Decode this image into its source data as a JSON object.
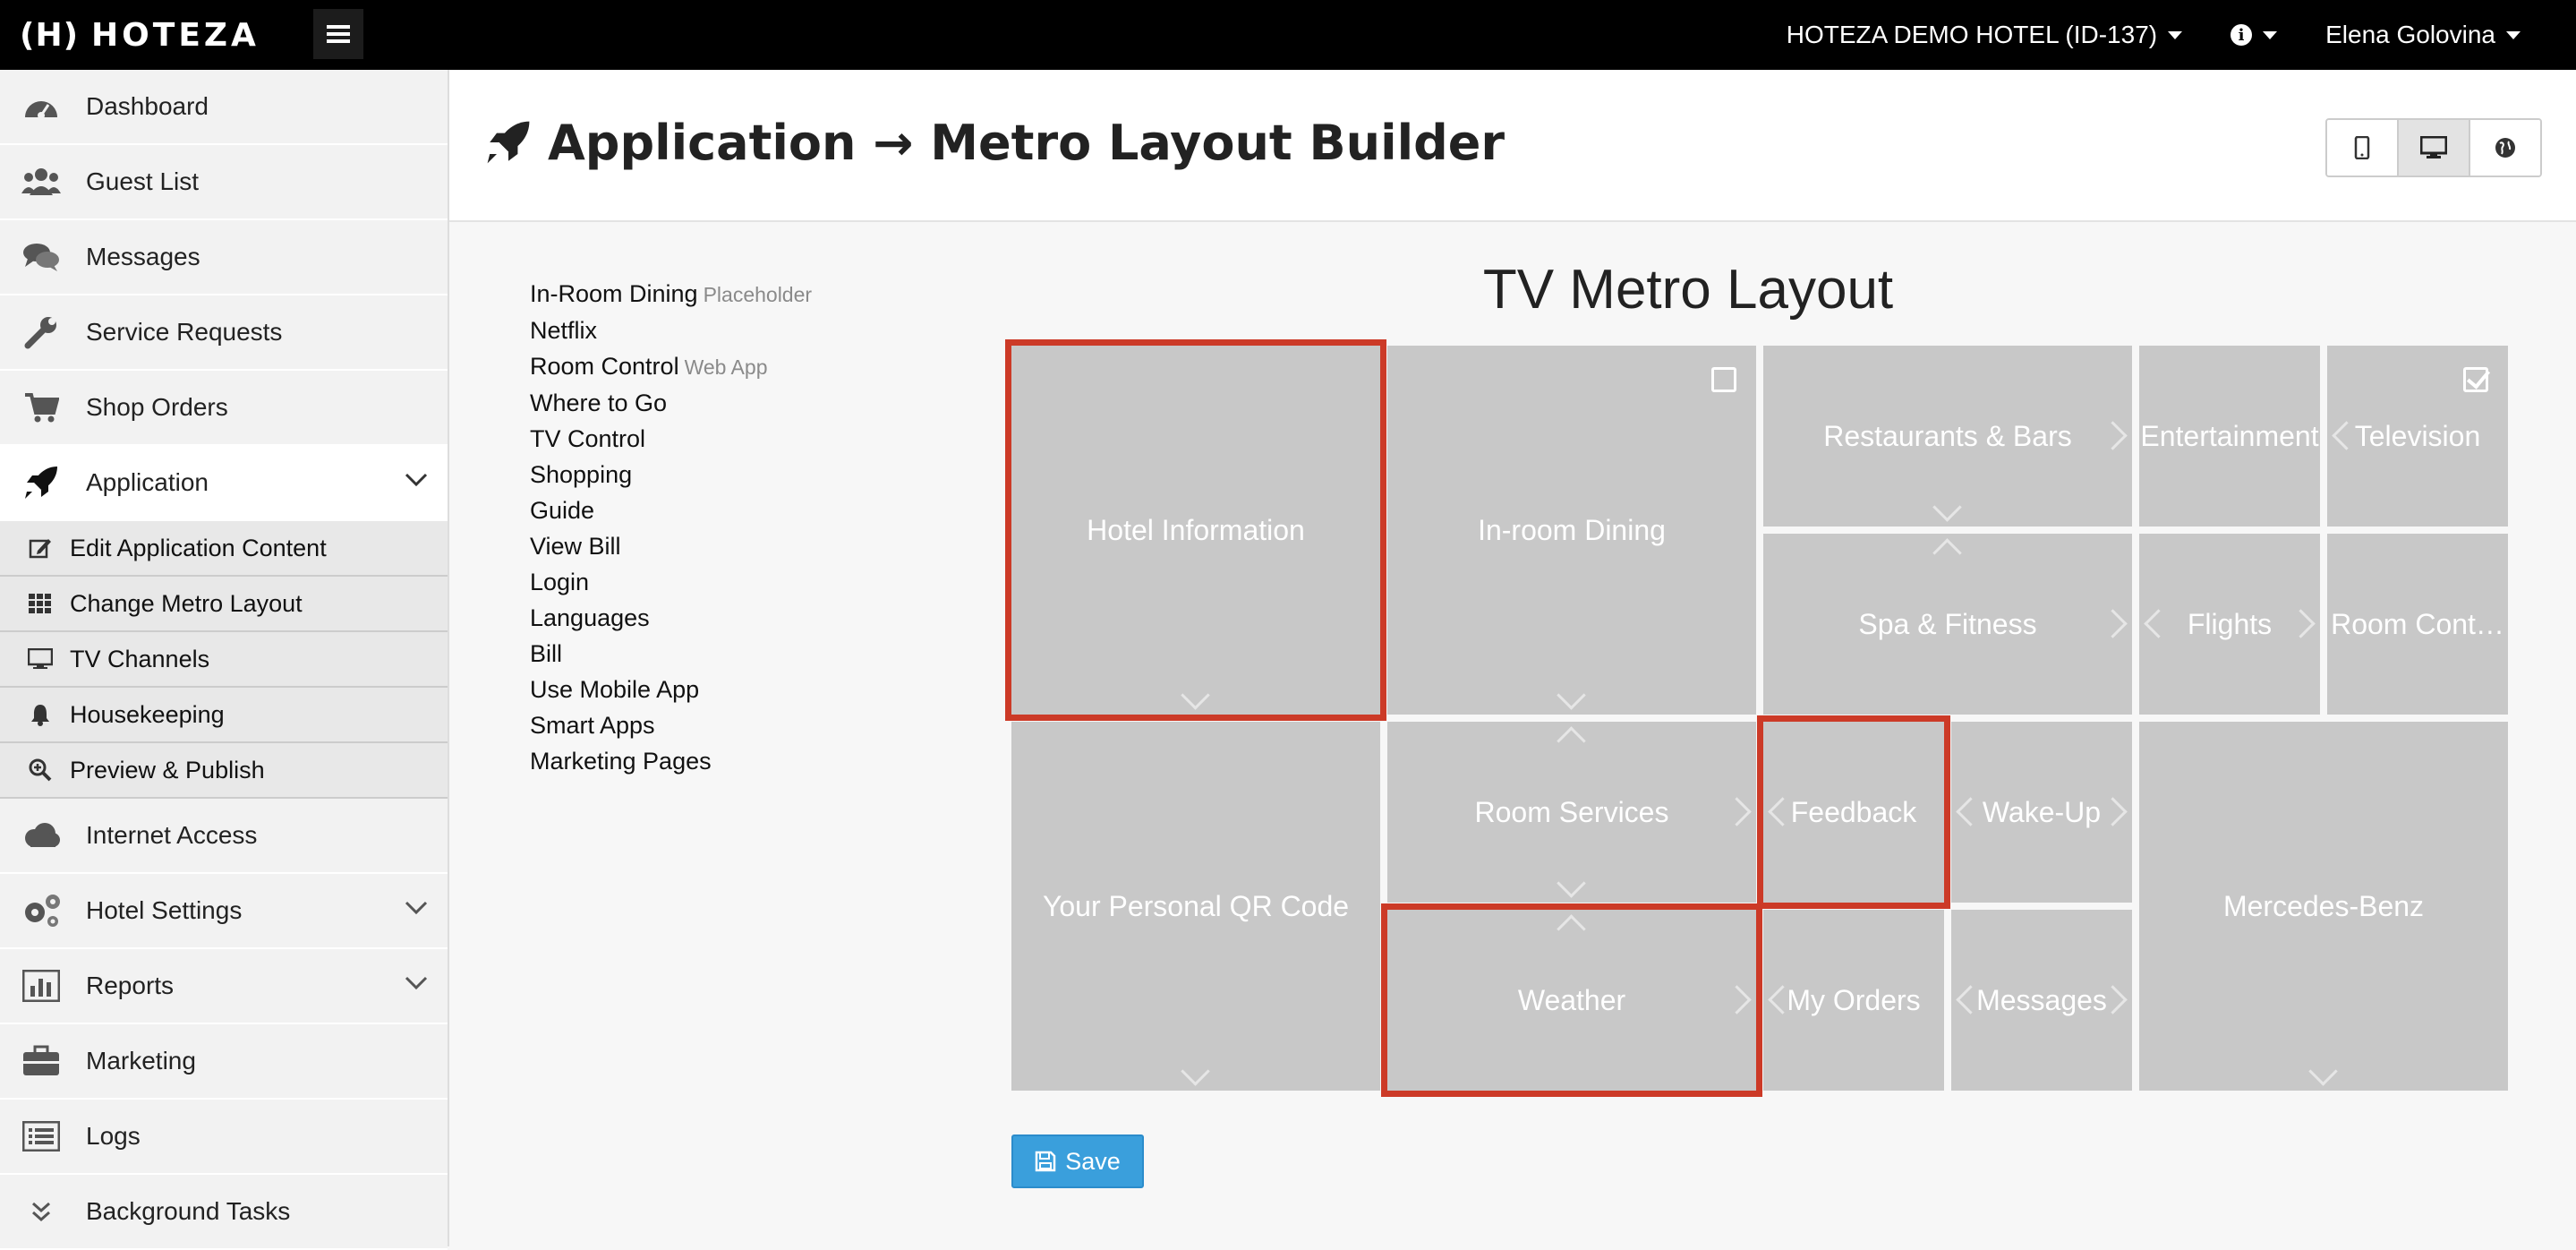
{
  "topbar": {
    "logo_mark": "(H)",
    "logo_text": "HOTEZA",
    "hotel": "HOTEZA DEMO HOTEL (ID-137)",
    "user": "Elena Golovina"
  },
  "sidebar": {
    "items": [
      {
        "label": "Dashboard",
        "icon": "dashboard-icon"
      },
      {
        "label": "Guest List",
        "icon": "users-icon"
      },
      {
        "label": "Messages",
        "icon": "comments-icon"
      },
      {
        "label": "Service Requests",
        "icon": "wrench-icon"
      },
      {
        "label": "Shop Orders",
        "icon": "cart-icon"
      },
      {
        "label": "Application",
        "icon": "rocket-icon"
      }
    ],
    "subitems": [
      {
        "label": "Edit Application Content"
      },
      {
        "label": "Change Metro Layout"
      },
      {
        "label": "TV Channels"
      },
      {
        "label": "Housekeeping"
      },
      {
        "label": "Preview & Publish"
      }
    ],
    "items2": [
      {
        "label": "Internet Access"
      },
      {
        "label": "Hotel Settings"
      },
      {
        "label": "Reports"
      },
      {
        "label": "Marketing"
      },
      {
        "label": "Logs"
      },
      {
        "label": "Background Tasks"
      }
    ]
  },
  "header": {
    "title": "Application → Metro Layout Builder"
  },
  "item_list": [
    {
      "label": "In-Room Dining",
      "tag": "Placeholder"
    },
    {
      "label": "Netflix",
      "tag": ""
    },
    {
      "label": "Room Control",
      "tag": "Web App"
    },
    {
      "label": "Where to Go",
      "tag": ""
    },
    {
      "label": "TV Control",
      "tag": ""
    },
    {
      "label": "Shopping",
      "tag": ""
    },
    {
      "label": "Guide",
      "tag": ""
    },
    {
      "label": "View Bill",
      "tag": ""
    },
    {
      "label": "Login",
      "tag": ""
    },
    {
      "label": "Languages",
      "tag": ""
    },
    {
      "label": "Bill",
      "tag": ""
    },
    {
      "label": "Use Mobile App",
      "tag": ""
    },
    {
      "label": "Smart Apps",
      "tag": ""
    },
    {
      "label": "Marketing Pages",
      "tag": ""
    }
  ],
  "layout": {
    "title": "TV Metro Layout",
    "tiles": {
      "hotel_information": "Hotel Information",
      "in_room_dining": "In-room Dining",
      "restaurants_bars": "Restaurants & Bars",
      "entertainment": "Entertainment",
      "television": "Television",
      "spa_fitness": "Spa & Fitness",
      "flights": "Flights",
      "room_control": "Room Cont…",
      "qr_code": "Your Personal QR Code",
      "room_services": "Room Services",
      "feedback": "Feedback",
      "wake_up": "Wake-Up",
      "mercedes": "Mercedes-Benz",
      "weather": "Weather",
      "my_orders": "My Orders",
      "messages": "Messages"
    }
  },
  "save_label": "Save",
  "colors": {
    "accent": "#3a9fdc",
    "selection": "#cc3a27",
    "tile": "#c8c8c8"
  }
}
